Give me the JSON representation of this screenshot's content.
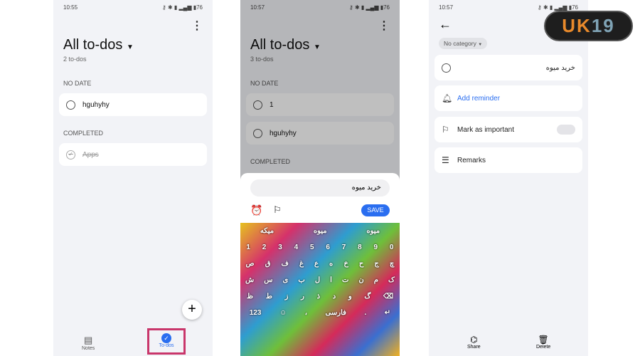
{
  "p1": {
    "time": "10:55",
    "title": "All to-dos",
    "count": "2 to-dos",
    "no_date": "NO DATE",
    "item": "hguhyhy",
    "completed": "COMPLETED",
    "done_item": "Apps",
    "nav_notes": "Notes",
    "nav_todos": "To-dos"
  },
  "p2": {
    "time": "10:57",
    "title": "All to-dos",
    "count": "3 to-dos",
    "no_date": "NO DATE",
    "items": [
      "1",
      "hguhyhy"
    ],
    "completed": "COMPLETED",
    "input": "خرید میوه",
    "save": "SAVE",
    "suggest": [
      "میکه",
      "میوه",
      "میوه"
    ],
    "keys": [
      [
        "1",
        "2",
        "3",
        "4",
        "5",
        "6",
        "7",
        "8",
        "9",
        "0"
      ],
      [
        "ص",
        "ق",
        "ف",
        "غ",
        "ع",
        "ه",
        "خ",
        "ح",
        "ج",
        "چ"
      ],
      [
        "ش",
        "س",
        "ی",
        "ب",
        "ل",
        "ا",
        "ت",
        "ن",
        "م",
        "ک"
      ],
      [
        "ظ",
        "ط",
        "ز",
        "ر",
        "ذ",
        "د",
        "و",
        "گ",
        "⌫"
      ],
      [
        "123",
        "☺",
        "،",
        "فارسی",
        ".",
        "↵"
      ]
    ]
  },
  "p3": {
    "time": "10:57",
    "category": "No category",
    "task": "خرید میوه",
    "reminder": "Add reminder",
    "important": "Mark as important",
    "remarks": "Remarks",
    "share": "Share",
    "delete": "Delete"
  },
  "logo": "UK19",
  "accent": "#2a6ef0"
}
